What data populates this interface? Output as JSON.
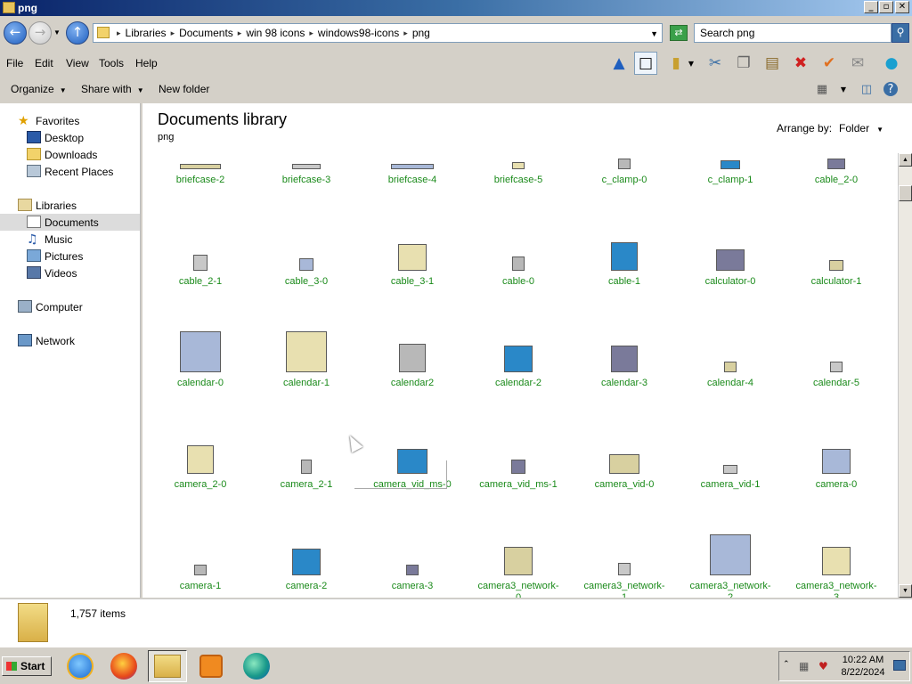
{
  "window": {
    "title": "png",
    "minimize": "_",
    "maximize": "▫",
    "close": "✕"
  },
  "address": {
    "crumbs": [
      "Libraries",
      "Documents",
      "win 98 icons",
      "windows98-icons",
      "png"
    ],
    "search_placeholder": "Search png"
  },
  "menu": {
    "items": [
      "File",
      "Edit",
      "View",
      "Tools",
      "Help"
    ]
  },
  "commands": {
    "organize": "Organize",
    "share_with": "Share with",
    "new_folder": "New folder"
  },
  "nav": {
    "favorites": "Favorites",
    "desktop": "Desktop",
    "downloads": "Downloads",
    "recent_places": "Recent Places",
    "libraries": "Libraries",
    "documents": "Documents",
    "music": "Music",
    "pictures": "Pictures",
    "videos": "Videos",
    "computer": "Computer",
    "network": "Network"
  },
  "library": {
    "title": "Documents library",
    "subtitle": "png",
    "arrange_label": "Arrange by:",
    "arrange_value": "Folder"
  },
  "files": [
    [
      "briefcase-2",
      "briefcase-3",
      "briefcase-4",
      "briefcase-5",
      "c_clamp-0",
      "c_clamp-1",
      "cable_2-0"
    ],
    [
      "cable_2-1",
      "cable_3-0",
      "cable_3-1",
      "cable-0",
      "cable-1",
      "calculator-0",
      "calculator-1"
    ],
    [
      "calendar-0",
      "calendar-1",
      "calendar2",
      "calendar-2",
      "calendar-3",
      "calendar-4",
      "calendar-5"
    ],
    [
      "camera_2-0",
      "camera_2-1",
      "camera_vid_ms-0",
      "camera_vid_ms-1",
      "camera_vid-0",
      "camera_vid-1",
      "camera-0"
    ],
    [
      "camera-1",
      "camera-2",
      "camera-3",
      "camera3_network-\n0",
      "camera3_network-\n1",
      "camera3_network-\n2",
      "camera3_network-\n3"
    ]
  ],
  "status": {
    "item_count": "1,757 items"
  },
  "taskbar": {
    "start": "Start",
    "time": "10:22 AM",
    "date": "8/22/2024"
  }
}
